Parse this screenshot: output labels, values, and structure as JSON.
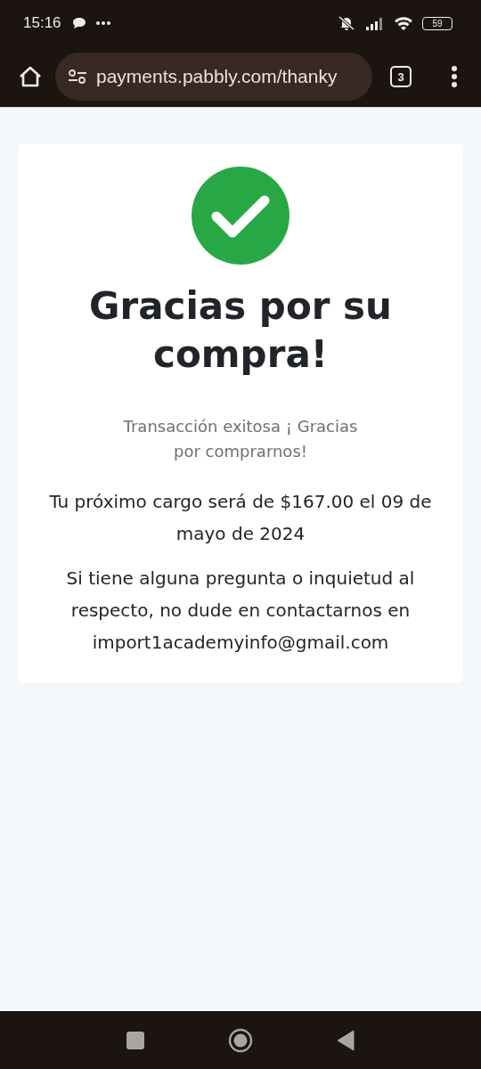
{
  "status_bar": {
    "time": "15:16",
    "battery": "59"
  },
  "browser": {
    "url": "payments.pabbly.com/thanky",
    "tab_count": "3"
  },
  "card": {
    "title": "Gracias por su compra!",
    "subtitle": "Transacción exitosa ¡ Gracias por comprarnos!",
    "next_charge": "Tu próximo cargo será de $167.00 el 09 de mayo de 2024",
    "contact": "Si tiene alguna pregunta o inquietud al respecto, no dude en contactarnos en import1academyinfo@gmail.com"
  }
}
